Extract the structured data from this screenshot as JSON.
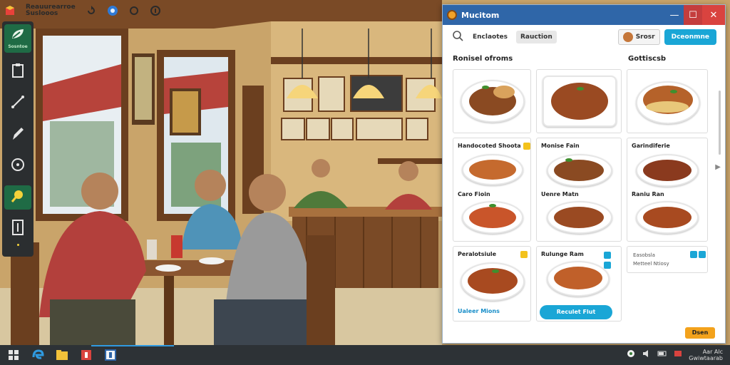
{
  "tray": {
    "title_line1": "Reauurearroe",
    "title_line2": "Suslooos"
  },
  "dock": {
    "home_label": "Sosntoe"
  },
  "window": {
    "title": "Mucitom",
    "controls": {
      "minimize": "—",
      "maximize": "☐",
      "close": "✕"
    }
  },
  "toolbar": {
    "tabs": [
      "Enclaotes",
      "Rauction"
    ],
    "selected_tab": "Rauction",
    "user_label": "Srosr",
    "cta_label": "Dceonmne"
  },
  "sections": {
    "left": "Ronisel ofroms",
    "right": "Gottiscsb"
  },
  "cards": [
    {
      "label": ""
    },
    {
      "label": ""
    },
    {
      "label": ""
    },
    {
      "label": "Handocoted Shoota"
    },
    {
      "label": "Monise Fain"
    },
    {
      "label": "Garindiferie"
    },
    {
      "label": "Caro Fioin"
    },
    {
      "label": "Uenre Matn"
    },
    {
      "label": "Raniu Ran"
    },
    {
      "label": "Peralotsiule"
    },
    {
      "label": "Rulunge Ram"
    }
  ],
  "card_extra": {
    "card9_link": "Ualeer Mions",
    "card10_button": "Reculet Flut",
    "info_line1": "Easobsla",
    "info_line2": "Metteel Ntiosy"
  },
  "done_label": "Dsen",
  "taskbar": {
    "clock_time": "Aar Alc",
    "clock_date": "Gwiwtaarab"
  },
  "colors": {
    "titlebar": "#2f66a8",
    "accent": "#1aa6d6",
    "dock_active": "#1f6b45",
    "done": "#f3a21c"
  }
}
